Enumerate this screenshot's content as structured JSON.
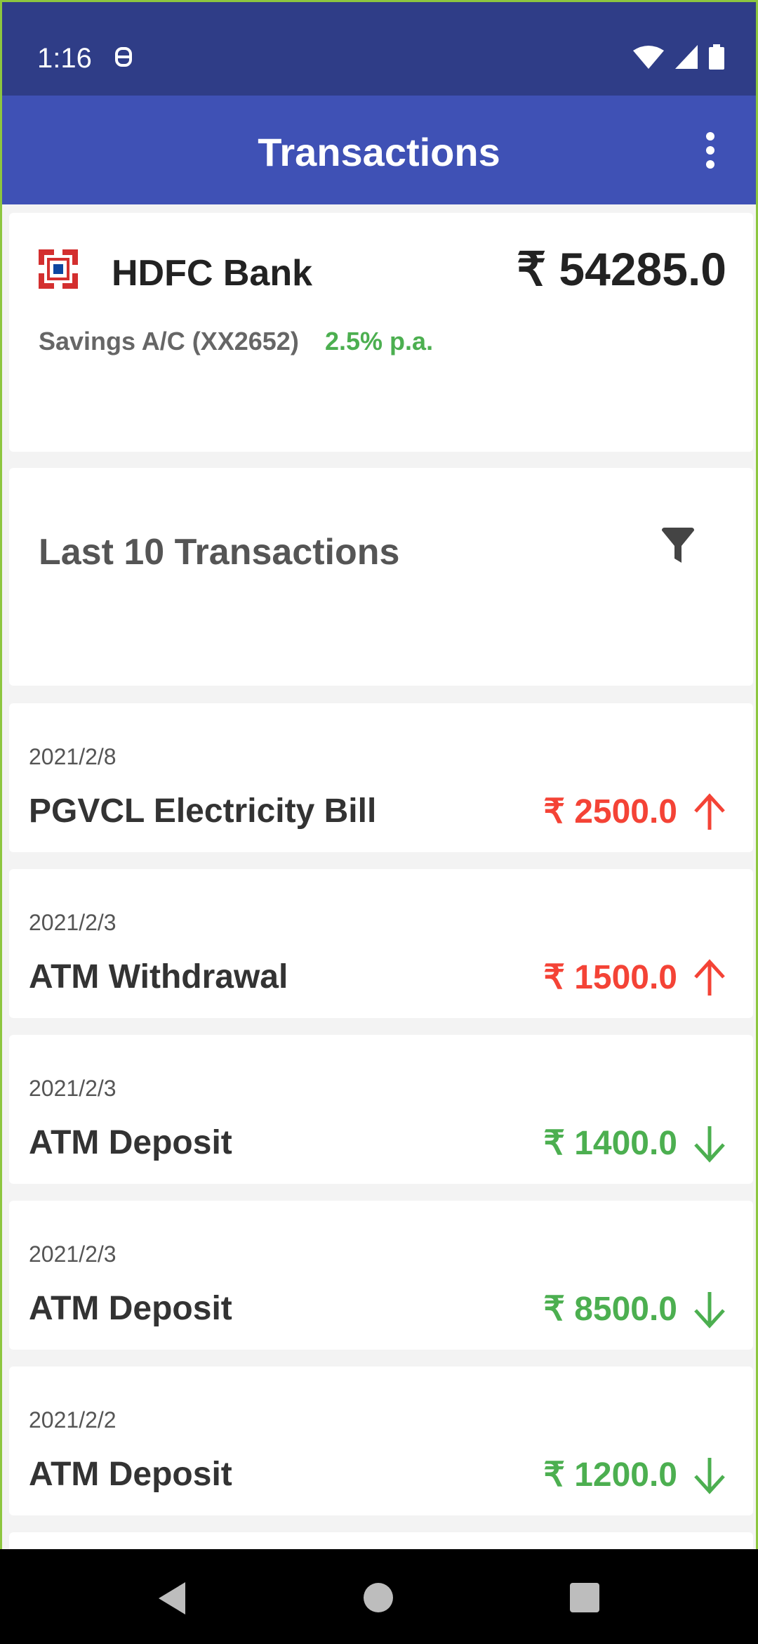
{
  "status_bar": {
    "time": "1:16"
  },
  "app_bar": {
    "title": "Transactions"
  },
  "account": {
    "bank_name": "HDFC Bank",
    "balance": "₹ 54285.0",
    "account_label": "Savings A/C (XX2652)",
    "interest_rate": "2.5% p.a."
  },
  "transactions_header": {
    "title": "Last 10 Transactions"
  },
  "transactions": [
    {
      "date": "2021/2/8",
      "description": "PGVCL Electricity Bill",
      "amount": "₹ 2500.0",
      "type": "debit"
    },
    {
      "date": "2021/2/3",
      "description": "ATM Withdrawal",
      "amount": "₹ 1500.0",
      "type": "debit"
    },
    {
      "date": "2021/2/3",
      "description": "ATM Deposit",
      "amount": "₹ 1400.0",
      "type": "credit"
    },
    {
      "date": "2021/2/3",
      "description": "ATM Deposit",
      "amount": "₹ 8500.0",
      "type": "credit"
    },
    {
      "date": "2021/2/2",
      "description": "ATM Deposit",
      "amount": "₹ 1200.0",
      "type": "credit"
    }
  ],
  "colors": {
    "status_bar": "#2f3d87",
    "app_bar": "#3f51b5",
    "debit": "#f44336",
    "credit": "#4caf50",
    "bank_logo": "#d32f2f"
  },
  "icons": {
    "overflow": "more-vert-icon",
    "filter": "filter-icon",
    "debit": "arrow-up-icon",
    "credit": "arrow-down-icon"
  }
}
